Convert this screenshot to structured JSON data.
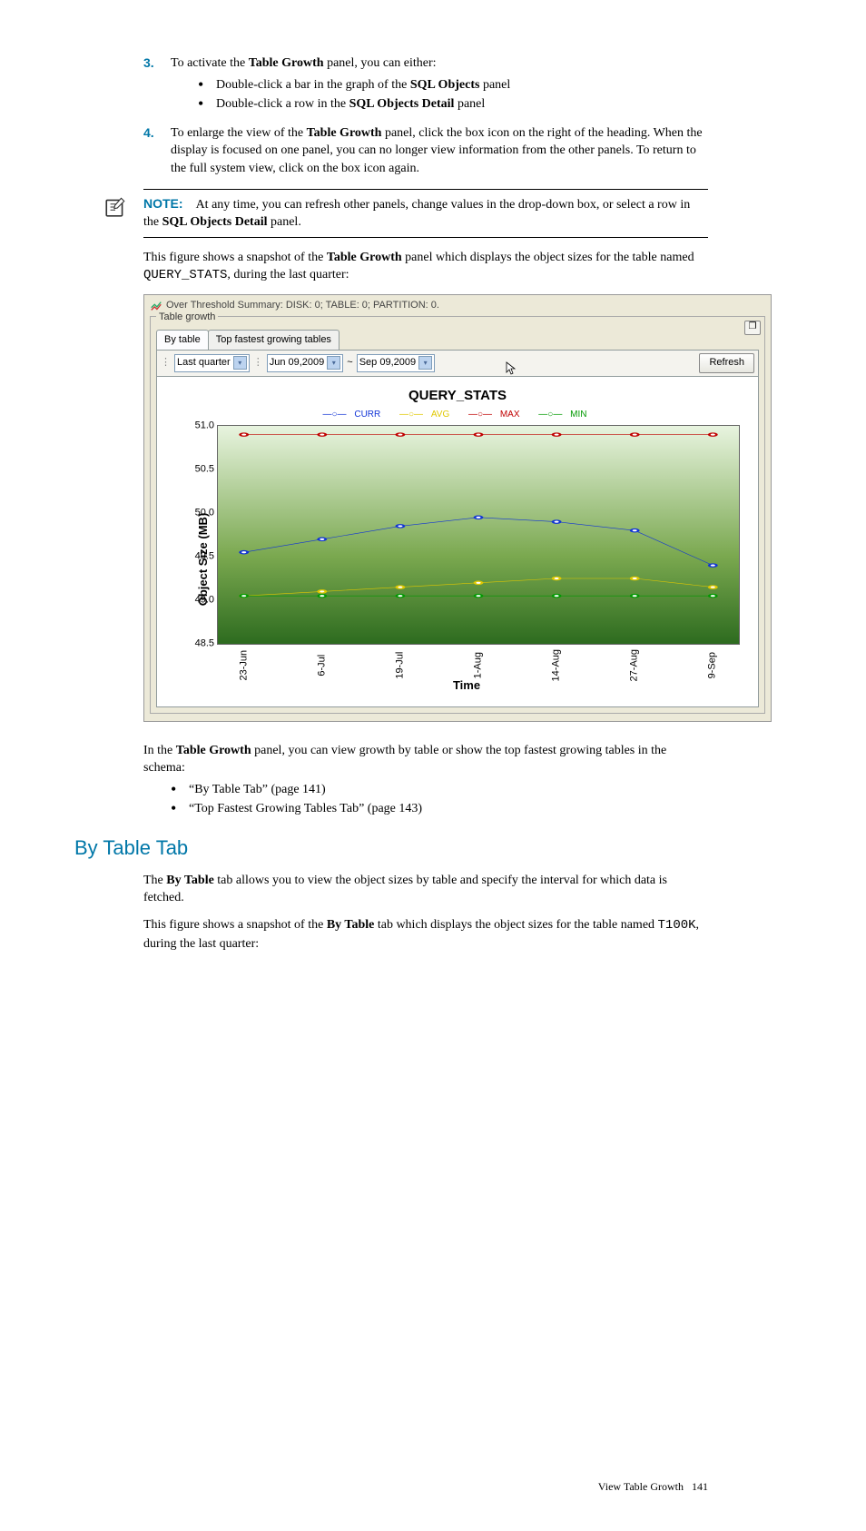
{
  "steps": {
    "s3": {
      "num": "3.",
      "text_a": "To activate the ",
      "bold_a": "Table Growth",
      "text_b": " panel, you can either:",
      "bullets": [
        {
          "a": "Double-click a bar in the graph of the ",
          "b": "SQL Objects",
          "c": " panel"
        },
        {
          "a": "Double-click a row in the ",
          "b": "SQL Objects Detail",
          "c": " panel"
        }
      ]
    },
    "s4": {
      "num": "4.",
      "text_a": "To enlarge the view of the ",
      "bold_a": "Table Growth",
      "text_b": " panel, click the box icon on the right of the heading. When the display is focused on one panel, you can no longer view information from the other panels. To return to the full system view, click on the box icon again."
    }
  },
  "note": {
    "label": "NOTE:",
    "text_a": "At any time, you can refresh other panels, change values in the drop-down box, or select a row in the ",
    "bold_a": "SQL Objects Detail",
    "text_b": " panel."
  },
  "intro": {
    "text_a": "This figure shows a snapshot of the ",
    "bold_a": "Table Growth",
    "text_b": " panel which displays the object sizes for the table named ",
    "mono_a": "QUERY_STATS",
    "text_c": ", during the last quarter:"
  },
  "ui": {
    "topbar": "Over Threshold Summary: DISK: 0; TABLE: 0; PARTITION: 0.",
    "fieldset_legend": "Table growth",
    "box_icon": "❐",
    "tabs": {
      "t1": "By table",
      "t2": "Top fastest growing tables"
    },
    "selects": {
      "s1": "Last quarter",
      "s2": "Jun 09,2009",
      "sep": "~",
      "s3": "Sep 09,2009"
    },
    "refresh": "Refresh",
    "chart_title": "QUERY_STATS",
    "legend": {
      "curr": "CURR",
      "avg": "AVG",
      "max": "MAX",
      "min": "MIN"
    },
    "ylabel": "Object Size (MB)",
    "xlabel": "Time",
    "yticks": [
      "51.0",
      "50.5",
      "50.0",
      "49.5",
      "49.0",
      "48.5"
    ],
    "xticks": [
      "23-Jun",
      "6-Jul",
      "19-Jul",
      "1-Aug",
      "14-Aug",
      "27-Aug",
      "9-Sep"
    ]
  },
  "chart_data": {
    "type": "line",
    "title": "QUERY_STATS",
    "xlabel": "Time",
    "ylabel": "Object Size (MB)",
    "ylim": [
      48.5,
      51.0
    ],
    "x": [
      "23-Jun",
      "6-Jul",
      "19-Jul",
      "1-Aug",
      "14-Aug",
      "27-Aug",
      "9-Sep"
    ],
    "series": [
      {
        "name": "CURR",
        "color": "#1033d6",
        "values": [
          49.55,
          49.7,
          49.85,
          49.95,
          49.9,
          49.8,
          49.4
        ]
      },
      {
        "name": "AVG",
        "color": "#e0c800",
        "values": [
          49.05,
          49.1,
          49.15,
          49.2,
          49.25,
          49.25,
          49.15
        ]
      },
      {
        "name": "MAX",
        "color": "#c00000",
        "values": [
          50.9,
          50.9,
          50.9,
          50.9,
          50.9,
          50.9,
          50.9
        ]
      },
      {
        "name": "MIN",
        "color": "#009900",
        "values": [
          49.05,
          49.05,
          49.05,
          49.05,
          49.05,
          49.05,
          49.05
        ]
      }
    ]
  },
  "after_chart": {
    "text_a": "In the ",
    "bold_a": "Table Growth",
    "text_b": " panel, you can view growth by table or show the top fastest growing tables in the schema:",
    "bullets": [
      "“By Table Tab” (page 141)",
      "“Top Fastest Growing Tables Tab” (page 143)"
    ]
  },
  "section": {
    "heading": "By Table Tab",
    "p1_a": "The ",
    "p1_b": "By Table",
    "p1_c": " tab allows you to view the object sizes by table and specify the interval for which data is fetched.",
    "p2_a": "This figure shows a snapshot of the ",
    "p2_b": "By Table",
    "p2_c": " tab which displays the object sizes for the table named ",
    "p2_mono": "T100K",
    "p2_d": ", during the last quarter:"
  },
  "footer": {
    "left": "View Table Growth",
    "page": "141"
  }
}
